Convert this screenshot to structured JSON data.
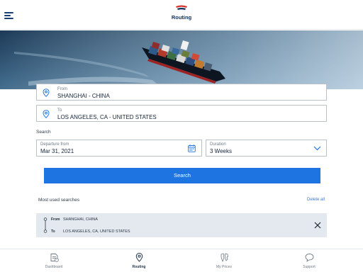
{
  "header": {
    "title": "Routing"
  },
  "from": {
    "label": "From",
    "value": "SHANGHAI - CHINA"
  },
  "to": {
    "label": "To",
    "value": "LOS ANGELES, CA - UNITED STATES"
  },
  "search_section": {
    "label": "Search"
  },
  "departure": {
    "label": "Departure from",
    "value": "Mar 31, 2021"
  },
  "duration": {
    "label": "Duration",
    "value": "3 Weeks"
  },
  "search_button": "Search",
  "most_used": {
    "title": "Most used searches",
    "delete_all": "Delete all",
    "items": [
      {
        "from_key": "From",
        "from": "SHANGHAI, CHINA",
        "to_key": "To",
        "to": "LOS ANGELES, CA, UNITED STATES"
      }
    ]
  },
  "nav": {
    "items": [
      {
        "label": "Dashboard",
        "icon": "dashboard-icon"
      },
      {
        "label": "Routing",
        "icon": "location-pin-icon",
        "active": true
      },
      {
        "label": "My Prices",
        "icon": "world-map-icon"
      },
      {
        "label": "Support",
        "icon": "chat-bubble-icon"
      }
    ]
  },
  "colors": {
    "primary": "#1e74e0",
    "brand_navy": "#0f2f5a",
    "logo_red": "#d8332a",
    "card_bg": "#e4e8ef"
  }
}
